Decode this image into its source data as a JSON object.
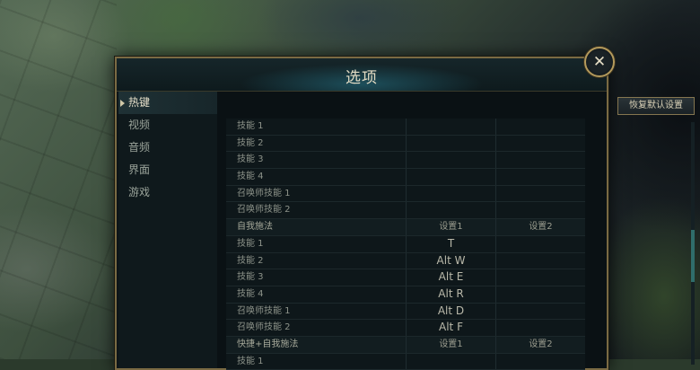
{
  "dialog": {
    "title": "选项",
    "close_symbol": "✕",
    "reset_label": "恢复默认设置"
  },
  "sidebar": {
    "items": [
      {
        "label": "热键",
        "active": true
      },
      {
        "label": "视频",
        "active": false
      },
      {
        "label": "音频",
        "active": false
      },
      {
        "label": "界面",
        "active": false
      },
      {
        "label": "游戏",
        "active": false
      }
    ]
  },
  "table": {
    "rows": [
      {
        "type": "row",
        "label": "技能 1",
        "key1": "",
        "key2": ""
      },
      {
        "type": "row",
        "label": "技能 2",
        "key1": "",
        "key2": ""
      },
      {
        "type": "row",
        "label": "技能 3",
        "key1": "",
        "key2": ""
      },
      {
        "type": "row",
        "label": "技能 4",
        "key1": "",
        "key2": ""
      },
      {
        "type": "row",
        "label": "召唤师技能 1",
        "key1": "",
        "key2": ""
      },
      {
        "type": "row",
        "label": "召唤师技能 2",
        "key1": "",
        "key2": ""
      },
      {
        "type": "header",
        "label": "自我施法",
        "key1": "设置1",
        "key2": "设置2"
      },
      {
        "type": "row",
        "label": "技能 1",
        "key1": "T",
        "key2": ""
      },
      {
        "type": "row",
        "label": "技能 2",
        "key1": "Alt  W",
        "key2": ""
      },
      {
        "type": "row",
        "label": "技能 3",
        "key1": "Alt  E",
        "key2": ""
      },
      {
        "type": "row",
        "label": "技能 4",
        "key1": "Alt  R",
        "key2": ""
      },
      {
        "type": "row",
        "label": "召唤师技能 1",
        "key1": "Alt  D",
        "key2": ""
      },
      {
        "type": "row",
        "label": "召唤师技能 2",
        "key1": "Alt  F",
        "key2": ""
      },
      {
        "type": "header",
        "label": "快捷+自我施法",
        "key1": "设置1",
        "key2": "设置2"
      },
      {
        "type": "row",
        "label": "技能 1",
        "key1": "",
        "key2": ""
      }
    ]
  },
  "colors": {
    "frame_gold": "#7a6a43",
    "scroll_accent": "#2f6d6b"
  },
  "icons": {
    "close": "close-icon",
    "active_marker": "caret-right-icon"
  }
}
